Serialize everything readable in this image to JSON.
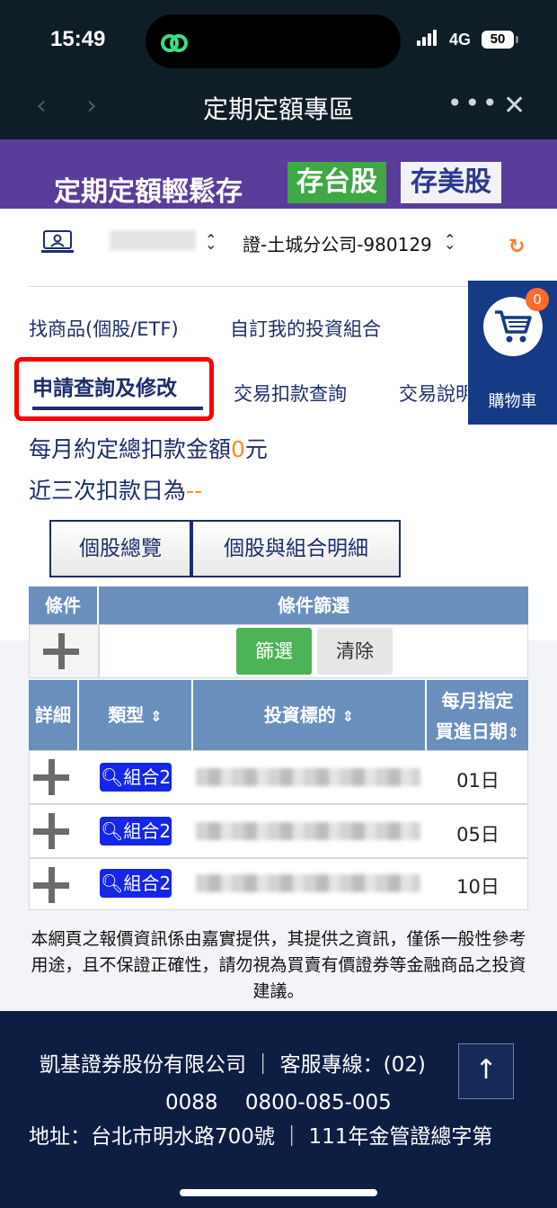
{
  "status": {
    "time": "15:49",
    "network": "4G",
    "battery": "50"
  },
  "nav": {
    "title": "定期定額專區",
    "back_icon": "chevron-left-icon",
    "forward_icon": "chevron-right-icon",
    "more": "•••",
    "close": "✕"
  },
  "banner": {
    "text": "定期定額輕鬆存",
    "tag_tw": "存台股",
    "tag_us": "存美股"
  },
  "account": {
    "branch": "證-土城分公司-980129"
  },
  "tabs": {
    "find": "找商品(個股/ETF)",
    "custom": "自訂我的投資組合",
    "query": "申請查詢及修改",
    "deduction": "交易扣款查詢",
    "explain": "交易說明"
  },
  "cart": {
    "count": "0",
    "label": "購物車"
  },
  "summary": {
    "monthly_prefix": "每月約定總扣款金額",
    "monthly_value": "0",
    "monthly_suffix": "元",
    "recent_prefix": "近三次扣款日為",
    "recent_value": "--"
  },
  "view_buttons": {
    "overview": "個股總覽",
    "detail": "個股與組合明細"
  },
  "filter": {
    "col_condition": "條件",
    "col_filter": "條件篩選",
    "btn_filter": "篩選",
    "btn_clear": "清除"
  },
  "table": {
    "headers": {
      "detail": "詳細",
      "type": "類型",
      "target": "投資標的",
      "date_line1": "每月指定",
      "date_line2": "買進日期"
    },
    "rows": [
      {
        "type": "組合2",
        "day": "01日"
      },
      {
        "type": "組合2",
        "day": "05日"
      },
      {
        "type": "組合2",
        "day": "10日"
      }
    ]
  },
  "disclaimer": "本網頁之報價資訊係由嘉實提供，其提供之資訊，僅係一般性參考用途，且不保證正確性，請勿視為買賣有價證券等金融商品之投資建議。",
  "footer": {
    "line1": "凱基證券股份有限公司 ｜ 客服專線：(02)",
    "line2": "0088　 0800-085-005",
    "line3": "地址：台北市明水路700號 ｜ 111年金管證總字第"
  }
}
